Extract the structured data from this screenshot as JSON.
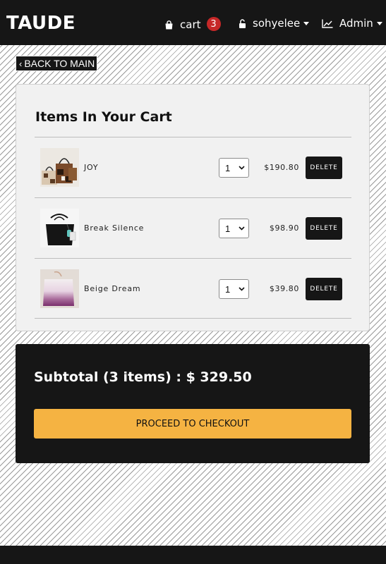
{
  "brand": "TAUDE",
  "nav": {
    "cart_label": "cart",
    "cart_count": "3",
    "user_label": "sohyelee",
    "admin_label": "Admin"
  },
  "back_label": "BACK TO MAIN",
  "cart": {
    "title": "Items In Your Cart",
    "items": [
      {
        "name": "JOY",
        "qty": "1",
        "price": "$190.80",
        "delete_label": "DELETE"
      },
      {
        "name": "Break Silence",
        "qty": "1",
        "price": "$98.90",
        "delete_label": "DELETE"
      },
      {
        "name": "Beige Dream",
        "qty": "1",
        "price": "$39.80",
        "delete_label": "DELETE"
      }
    ]
  },
  "summary": {
    "subtotal": "Subtotal (3 items) : $ 329.50",
    "checkout_label": "PROCEED TO CHECKOUT"
  },
  "colors": {
    "dark": "#161616",
    "accent": "#f5b342",
    "badge": "#c62828"
  }
}
